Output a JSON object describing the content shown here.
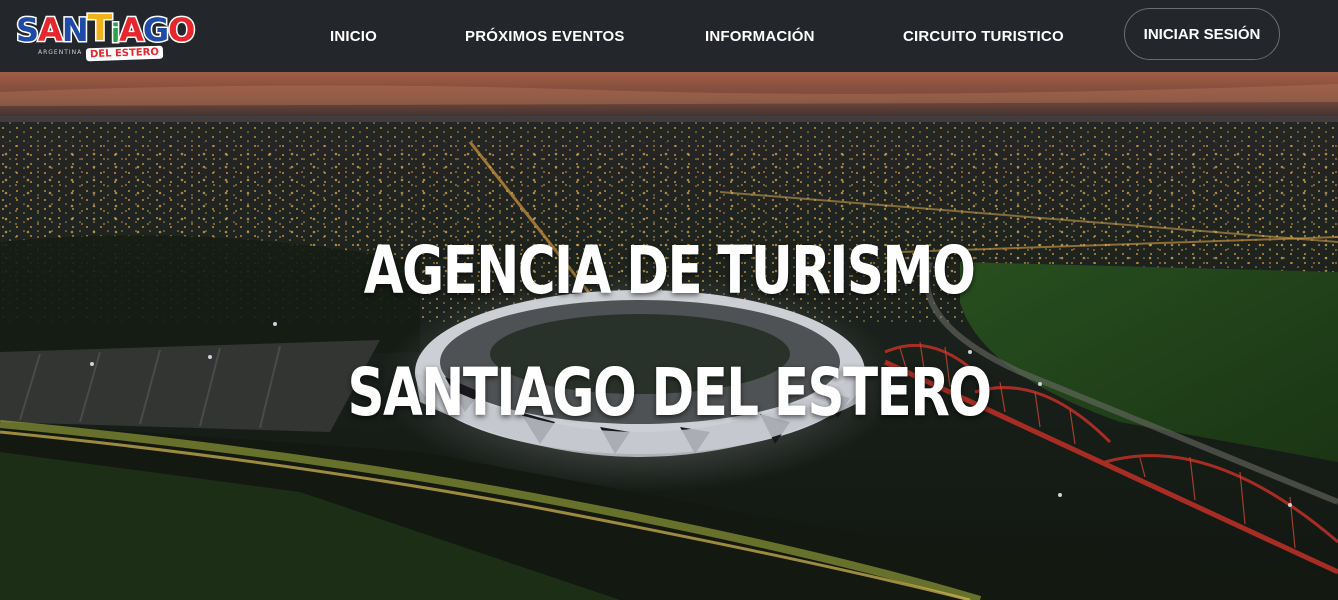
{
  "brand": {
    "logo_letters": [
      "S",
      "A",
      "N",
      "T",
      "i",
      "A",
      "G",
      "O"
    ],
    "logo_country": "ARGENTINA",
    "logo_badge": "DEL ESTERO"
  },
  "nav": {
    "items": [
      {
        "label": "INICIO"
      },
      {
        "label": "PRÓXIMOS EVENTOS"
      },
      {
        "label": "INFORMACIÓN"
      },
      {
        "label": "CIRCUITO TURISTICO"
      }
    ],
    "login_label": "INICIAR SESIÓN"
  },
  "hero": {
    "title_line1": "AGENCIA DE TURISMO",
    "title_line2": "SANTIAGO DEL ESTERO",
    "background": "aerial-night-city-stadium-bridge"
  },
  "colors": {
    "navbar_bg": "#23262b",
    "logo_blue": "#1e4aa8",
    "logo_red": "#e8262d",
    "logo_yellow": "#f2b21b",
    "logo_green": "#2aa34a",
    "bridge_red": "#c8362a",
    "city_lights": "#f5b04a"
  }
}
